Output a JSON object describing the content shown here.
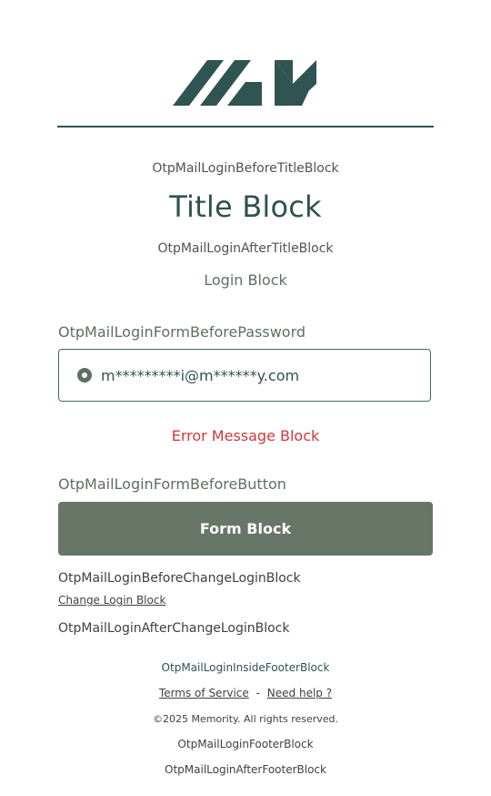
{
  "header": {
    "logo_name": "memority-logo"
  },
  "blocks": {
    "before_title": "OtpMailLoginBeforeTitleBlock",
    "title": "Title Block",
    "after_title": "OtpMailLoginAfterTitleBlock",
    "login": "Login Block",
    "before_password": "OtpMailLoginFormBeforePassword",
    "error_message": "Error Message Block",
    "before_button": "OtpMailLoginFormBeforeButton",
    "before_change_login": "OtpMailLoginBeforeChangeLoginBlock",
    "after_change_login": "OtpMailLoginAfterChangeLoginBlock"
  },
  "form": {
    "email_option": "m*********i@m******y.com",
    "submit_label": "Form Block",
    "change_login_link": "Change Login Block"
  },
  "footer": {
    "inside": "OtpMailLoginInsideFooterBlock",
    "terms_link": "Terms of Service",
    "separator": "-",
    "help_link": "Need help ?",
    "copyright": "©2025 Memority. All rights reserved.",
    "footer_block": "OtpMailLoginFooterBlock",
    "after_footer": "OtpMailLoginAfterFooterBlock"
  },
  "colors": {
    "brand_dark_teal": "#2f5452",
    "button_green": "#687667",
    "error_red": "#d0393b"
  }
}
